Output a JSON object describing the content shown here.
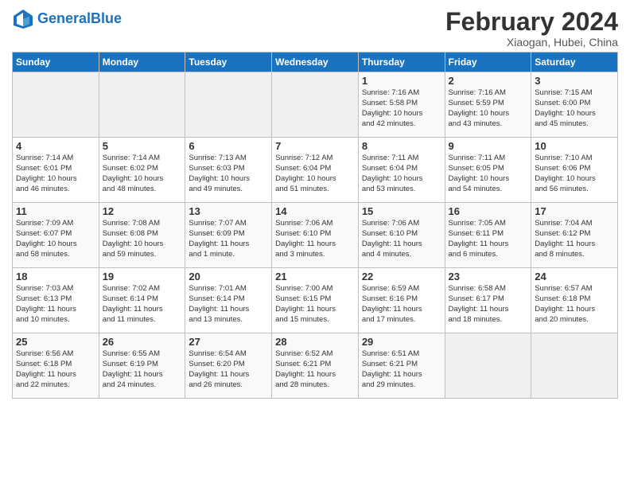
{
  "logo": {
    "text_general": "General",
    "text_blue": "Blue"
  },
  "header": {
    "month_year": "February 2024",
    "location": "Xiaogan, Hubei, China"
  },
  "days_of_week": [
    "Sunday",
    "Monday",
    "Tuesday",
    "Wednesday",
    "Thursday",
    "Friday",
    "Saturday"
  ],
  "weeks": [
    [
      {
        "day": "",
        "info": ""
      },
      {
        "day": "",
        "info": ""
      },
      {
        "day": "",
        "info": ""
      },
      {
        "day": "",
        "info": ""
      },
      {
        "day": "1",
        "info": "Sunrise: 7:16 AM\nSunset: 5:58 PM\nDaylight: 10 hours\nand 42 minutes."
      },
      {
        "day": "2",
        "info": "Sunrise: 7:16 AM\nSunset: 5:59 PM\nDaylight: 10 hours\nand 43 minutes."
      },
      {
        "day": "3",
        "info": "Sunrise: 7:15 AM\nSunset: 6:00 PM\nDaylight: 10 hours\nand 45 minutes."
      }
    ],
    [
      {
        "day": "4",
        "info": "Sunrise: 7:14 AM\nSunset: 6:01 PM\nDaylight: 10 hours\nand 46 minutes."
      },
      {
        "day": "5",
        "info": "Sunrise: 7:14 AM\nSunset: 6:02 PM\nDaylight: 10 hours\nand 48 minutes."
      },
      {
        "day": "6",
        "info": "Sunrise: 7:13 AM\nSunset: 6:03 PM\nDaylight: 10 hours\nand 49 minutes."
      },
      {
        "day": "7",
        "info": "Sunrise: 7:12 AM\nSunset: 6:04 PM\nDaylight: 10 hours\nand 51 minutes."
      },
      {
        "day": "8",
        "info": "Sunrise: 7:11 AM\nSunset: 6:04 PM\nDaylight: 10 hours\nand 53 minutes."
      },
      {
        "day": "9",
        "info": "Sunrise: 7:11 AM\nSunset: 6:05 PM\nDaylight: 10 hours\nand 54 minutes."
      },
      {
        "day": "10",
        "info": "Sunrise: 7:10 AM\nSunset: 6:06 PM\nDaylight: 10 hours\nand 56 minutes."
      }
    ],
    [
      {
        "day": "11",
        "info": "Sunrise: 7:09 AM\nSunset: 6:07 PM\nDaylight: 10 hours\nand 58 minutes."
      },
      {
        "day": "12",
        "info": "Sunrise: 7:08 AM\nSunset: 6:08 PM\nDaylight: 10 hours\nand 59 minutes."
      },
      {
        "day": "13",
        "info": "Sunrise: 7:07 AM\nSunset: 6:09 PM\nDaylight: 11 hours\nand 1 minute."
      },
      {
        "day": "14",
        "info": "Sunrise: 7:06 AM\nSunset: 6:10 PM\nDaylight: 11 hours\nand 3 minutes."
      },
      {
        "day": "15",
        "info": "Sunrise: 7:06 AM\nSunset: 6:10 PM\nDaylight: 11 hours\nand 4 minutes."
      },
      {
        "day": "16",
        "info": "Sunrise: 7:05 AM\nSunset: 6:11 PM\nDaylight: 11 hours\nand 6 minutes."
      },
      {
        "day": "17",
        "info": "Sunrise: 7:04 AM\nSunset: 6:12 PM\nDaylight: 11 hours\nand 8 minutes."
      }
    ],
    [
      {
        "day": "18",
        "info": "Sunrise: 7:03 AM\nSunset: 6:13 PM\nDaylight: 11 hours\nand 10 minutes."
      },
      {
        "day": "19",
        "info": "Sunrise: 7:02 AM\nSunset: 6:14 PM\nDaylight: 11 hours\nand 11 minutes."
      },
      {
        "day": "20",
        "info": "Sunrise: 7:01 AM\nSunset: 6:14 PM\nDaylight: 11 hours\nand 13 minutes."
      },
      {
        "day": "21",
        "info": "Sunrise: 7:00 AM\nSunset: 6:15 PM\nDaylight: 11 hours\nand 15 minutes."
      },
      {
        "day": "22",
        "info": "Sunrise: 6:59 AM\nSunset: 6:16 PM\nDaylight: 11 hours\nand 17 minutes."
      },
      {
        "day": "23",
        "info": "Sunrise: 6:58 AM\nSunset: 6:17 PM\nDaylight: 11 hours\nand 18 minutes."
      },
      {
        "day": "24",
        "info": "Sunrise: 6:57 AM\nSunset: 6:18 PM\nDaylight: 11 hours\nand 20 minutes."
      }
    ],
    [
      {
        "day": "25",
        "info": "Sunrise: 6:56 AM\nSunset: 6:18 PM\nDaylight: 11 hours\nand 22 minutes."
      },
      {
        "day": "26",
        "info": "Sunrise: 6:55 AM\nSunset: 6:19 PM\nDaylight: 11 hours\nand 24 minutes."
      },
      {
        "day": "27",
        "info": "Sunrise: 6:54 AM\nSunset: 6:20 PM\nDaylight: 11 hours\nand 26 minutes."
      },
      {
        "day": "28",
        "info": "Sunrise: 6:52 AM\nSunset: 6:21 PM\nDaylight: 11 hours\nand 28 minutes."
      },
      {
        "day": "29",
        "info": "Sunrise: 6:51 AM\nSunset: 6:21 PM\nDaylight: 11 hours\nand 29 minutes."
      },
      {
        "day": "",
        "info": ""
      },
      {
        "day": "",
        "info": ""
      }
    ]
  ]
}
